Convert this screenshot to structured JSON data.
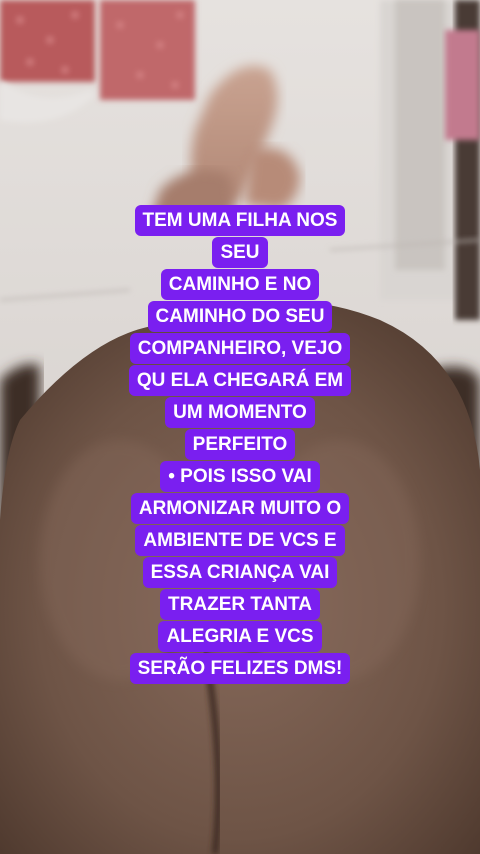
{
  "story": {
    "caption_lines": [
      "TEM UMA FILHA NOS",
      "SEU",
      "CAMINHO E NO",
      "CAMINHO DO SEU",
      "COMPANHEIRO, VEJO",
      "QU ELA CHEGARÁ EM",
      "UM MOMENTO",
      "PERFEITO",
      "• POIS ISSO VAI",
      "ARMONIZAR MUITO O",
      "AMBIENTE DE VCS E",
      "ESSA CRIANÇA VAI",
      "TRAZER TANTA",
      "ALEGRIA E VCS",
      "SERÃO FELIZES DMS!"
    ]
  },
  "colors": {
    "caption_background": "#7a1ff0",
    "caption_text": "#ffffff"
  }
}
